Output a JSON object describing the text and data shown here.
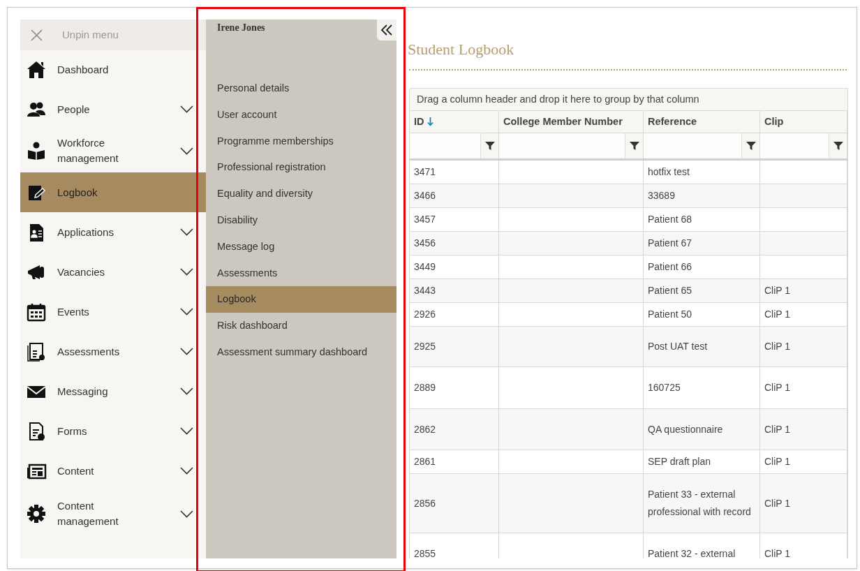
{
  "sidebar": {
    "unpin_label": "Unpin menu",
    "items": [
      {
        "label": "Dashboard",
        "expandable": false,
        "selected": false
      },
      {
        "label": "People",
        "expandable": true,
        "selected": false
      },
      {
        "label": "Workforce management",
        "expandable": true,
        "selected": false
      },
      {
        "label": "Logbook",
        "expandable": false,
        "selected": true
      },
      {
        "label": "Applications",
        "expandable": true,
        "selected": false
      },
      {
        "label": "Vacancies",
        "expandable": true,
        "selected": false
      },
      {
        "label": "Events",
        "expandable": true,
        "selected": false
      },
      {
        "label": "Assessments",
        "expandable": true,
        "selected": false
      },
      {
        "label": "Messaging",
        "expandable": true,
        "selected": false
      },
      {
        "label": "Forms",
        "expandable": true,
        "selected": false
      },
      {
        "label": "Content",
        "expandable": true,
        "selected": false
      },
      {
        "label": "Content management",
        "expandable": true,
        "selected": false
      }
    ]
  },
  "submenu": {
    "user_name": "Irene Jones",
    "items": [
      {
        "label": "Personal details",
        "selected": false
      },
      {
        "label": "User account",
        "selected": false
      },
      {
        "label": "Programme memberships",
        "selected": false
      },
      {
        "label": "Professional registration",
        "selected": false
      },
      {
        "label": "Equality and diversity",
        "selected": false
      },
      {
        "label": "Disability",
        "selected": false
      },
      {
        "label": "Message log",
        "selected": false
      },
      {
        "label": "Assessments",
        "selected": false
      },
      {
        "label": "Logbook",
        "selected": true
      },
      {
        "label": "Risk dashboard",
        "selected": false
      },
      {
        "label": "Assessment summary dashboard",
        "selected": false
      }
    ]
  },
  "highlight_frame": {
    "shown": true,
    "color": "#e8000b"
  },
  "page": {
    "title": "Student Logbook",
    "group_hint": "Drag a column header and drop it here to group by that column",
    "table": {
      "columns": [
        {
          "label": "ID",
          "sorted": true
        },
        {
          "label": "College Member Number",
          "sorted": false
        },
        {
          "label": "Reference",
          "sorted": false
        },
        {
          "label": "Clip",
          "sorted": false
        }
      ],
      "rows": [
        [
          "3471",
          "",
          "hotfix test",
          ""
        ],
        [
          "3466",
          "",
          "33689",
          ""
        ],
        [
          "3457",
          "",
          "Patient 68",
          ""
        ],
        [
          "3456",
          "",
          "Patient 67",
          ""
        ],
        [
          "3449",
          "",
          "Patient 66",
          ""
        ],
        [
          "3443",
          "",
          "Patient 65",
          "CliP 1"
        ],
        [
          "2926",
          "",
          "Patient 50",
          "CliP 1"
        ],
        [
          "2925",
          "",
          "Post UAT test",
          "CliP 1"
        ],
        [
          "2889",
          "",
          "160725",
          "CliP 1"
        ],
        [
          "2862",
          "",
          "QA questionnaire",
          "CliP 1"
        ],
        [
          "2861",
          "",
          "SEP draft plan",
          "CliP 1"
        ],
        [
          "2856",
          "",
          "Patient 33 - external professional with record",
          "CliP 1"
        ],
        [
          "2855",
          "",
          "Patient 32 - external",
          "CliP 1"
        ]
      ]
    }
  }
}
